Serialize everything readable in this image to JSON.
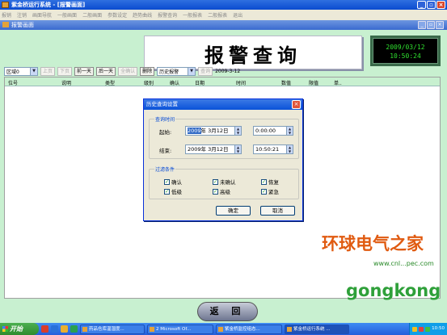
{
  "window": {
    "title": "紫金桥运行系统 - [报警画面]",
    "buttons": {
      "minimize": "_",
      "restore": "▫",
      "close": "×"
    }
  },
  "menu": [
    "报销",
    "注销",
    "画面导航",
    "一般画面",
    "二般画面",
    "参数设定",
    "趋势曲线",
    "报警查询",
    "一般报表",
    "二般报表",
    "退出"
  ],
  "inner_window": {
    "title": "报警画面"
  },
  "banner": {
    "title": "报警查询"
  },
  "clock": {
    "date": "2009/03/12",
    "time": "10:50:24"
  },
  "toolbar": {
    "area_select": "区域0",
    "btn_first": "上页",
    "btn_prev": "下页",
    "btn_prev_day": "前一天",
    "btn_next_day": "后一天",
    "btn_confirm": "全确认",
    "btn_delete": "删除",
    "mode_select": "历史报警",
    "btn_query": "查询",
    "date_label": "2009-3-12"
  },
  "grid": {
    "columns": [
      "位号",
      "说明",
      "类型",
      "级别",
      "确认",
      "日期",
      "时间",
      "数值",
      "限值",
      "单.."
    ]
  },
  "back_button": "返  回",
  "dialog": {
    "title": "历史查询设置",
    "close": "×",
    "time_group": "查询时间",
    "start_label": "起始:",
    "start_date_hl": "2009",
    "start_date_rest": "年  3月12日",
    "start_time": "0:00:00",
    "end_label": "结束:",
    "end_date": "2009年  3月12日",
    "end_time": "10:50:21",
    "filter_group": "过滤条件",
    "checkboxes": [
      {
        "label": "确认",
        "checked": true
      },
      {
        "label": "未确认",
        "checked": true
      },
      {
        "label": "恢复",
        "checked": true
      },
      {
        "label": "低级",
        "checked": true
      },
      {
        "label": "高级",
        "checked": true
      },
      {
        "label": "紧急",
        "checked": true
      }
    ],
    "ok": "确定",
    "cancel": "取消"
  },
  "taskbar": {
    "start": "开始",
    "tasks": [
      "药品仓库温湿度...",
      "2 Microsoft Of...",
      "紫金桥监控组态...",
      "紫金桥运行系统 ..."
    ],
    "clock": "10:50"
  },
  "watermark": {
    "main": "环球电气之家",
    "url": "www.cnl...pec.com",
    "sub": "gongkong"
  },
  "colors": {
    "content_bg": "#c8f0d0",
    "title_blue": "#0a4bd0",
    "clock_green": "#2fe02f"
  }
}
